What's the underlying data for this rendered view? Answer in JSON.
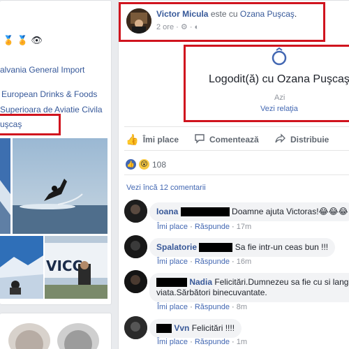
{
  "left": {
    "badges": [
      "🏅",
      "🏅",
      "👁"
    ],
    "lines": [
      "alvania General Import",
      "European Drinks & Foods",
      "Superioara de Aviatie Civila",
      "uşcaş"
    ]
  },
  "post": {
    "author": "Victor Micula",
    "with_text": "este cu",
    "tagged": "Ozana Puşcaş",
    "time": "2 ore",
    "event": {
      "title": "Logodit(ă) cu Ozana Puşcaş",
      "date": "Azi",
      "link": "Vezi relaţia"
    },
    "actions": {
      "like": "Îmi place",
      "comment": "Comentează",
      "share": "Distribuie"
    },
    "reaction_count": "108",
    "more_comments": "Vezi încă 12 comentarii",
    "comments": [
      {
        "name": "Ioana",
        "text": "Doamne ajuta Victoras!😂😂😂",
        "time": "17m"
      },
      {
        "name": "Spalatorie",
        "text": "Sa fie intr-un ceas bun !!!",
        "time": "16m"
      },
      {
        "name": "Nadia",
        "text": "Felicitări.Dumnezeu sa fie cu si langa v",
        "text2": "viata.Sărbători binecuvantate.",
        "time": "8m"
      },
      {
        "name": "Vvn",
        "text": "Felicitări !!!!",
        "time": "1m"
      }
    ],
    "comment_like": "Îmi place",
    "comment_reply": "Răspunde"
  },
  "colors": {
    "accent": "#365899",
    "highlight": "#d0141e"
  }
}
